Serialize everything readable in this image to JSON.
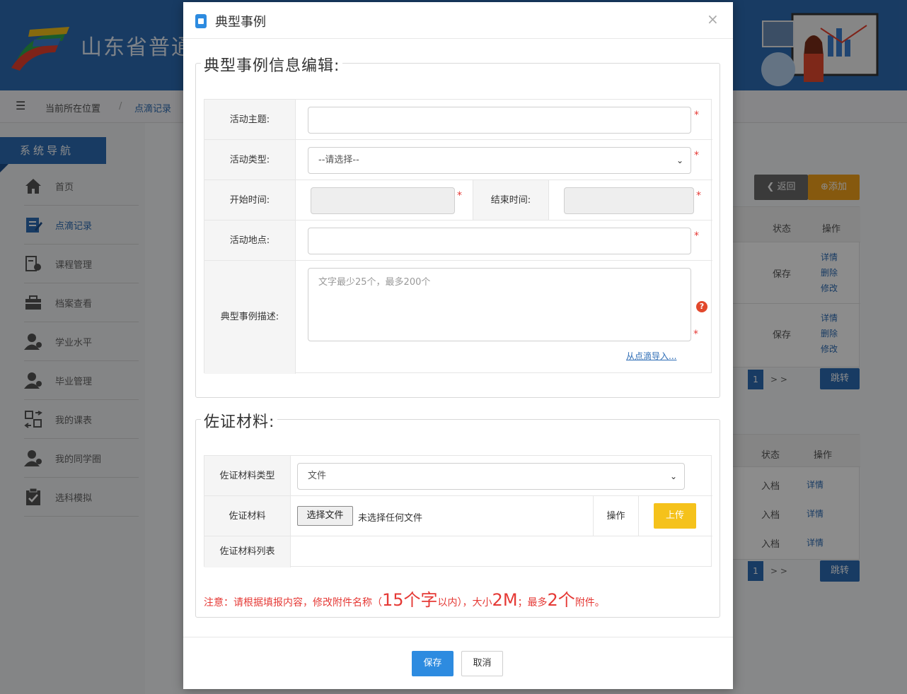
{
  "app": {
    "title": "山东省普通",
    "breadcrumb": {
      "label": "当前所在位置",
      "current": "点滴记录"
    }
  },
  "sidebar": {
    "title": "系统导航",
    "items": [
      {
        "label": "首页",
        "icon": "home-icon"
      },
      {
        "label": "点滴记录",
        "icon": "edit-icon",
        "active": true
      },
      {
        "label": "课程管理",
        "icon": "course-icon"
      },
      {
        "label": "档案查看",
        "icon": "briefcase-icon"
      },
      {
        "label": "学业水平",
        "icon": "user-icon"
      },
      {
        "label": "毕业管理",
        "icon": "user-icon"
      },
      {
        "label": "我的课表",
        "icon": "schedule-icon"
      },
      {
        "label": "我的同学圈",
        "icon": "user-icon"
      },
      {
        "label": "选科模拟",
        "icon": "clipboard-icon"
      }
    ]
  },
  "background": {
    "back_button": "返回",
    "add_button": "添加",
    "status_header": "状态",
    "action_header": "操作",
    "rows_top": [
      {
        "status": "保存",
        "actions": [
          "详情",
          "删除",
          "修改"
        ]
      },
      {
        "status": "保存",
        "actions": [
          "详情",
          "删除",
          "修改"
        ]
      }
    ],
    "rows_bottom": [
      {
        "status": "入档",
        "action": "详情"
      },
      {
        "status": "入档",
        "action": "详情"
      },
      {
        "status": "入档",
        "action": "详情"
      }
    ],
    "page_current": "1",
    "page_next": "> >",
    "jump_button": "跳转"
  },
  "modal": {
    "title": "典型事例",
    "close": "×",
    "info_section": {
      "legend": "典型事例信息编辑:",
      "topic_label": "活动主题:",
      "topic_value": "",
      "type_label": "活动类型:",
      "type_selected": "--请选择--",
      "start_label": "开始时间:",
      "end_label": "结束时间:",
      "place_label": "活动地点:",
      "place_value": "",
      "desc_label": "典型事例描述:",
      "desc_placeholder": "文字最少25个，最多200个",
      "import_link": "从点滴导入...",
      "required_mark": "*",
      "help": "?"
    },
    "evidence_section": {
      "legend": "佐证材料:",
      "type_label": "佐证材料类型",
      "type_selected": "文件",
      "material_label": "佐证材料",
      "choose_file": "选择文件",
      "no_file": "未选择任何文件",
      "action_label": "操作",
      "upload_button": "上传",
      "list_label": "佐证材料列表",
      "note_parts": [
        "注意：请根据填报内容，修改附件名称（",
        "15个字",
        "以内），大小",
        "2M",
        "；最多",
        "2个",
        "附件。"
      ]
    },
    "save_button": "保存",
    "cancel_button": "取消"
  },
  "colors": {
    "primary": "#2d6cb5",
    "upload": "#f5c21b",
    "required": "#e53935"
  }
}
